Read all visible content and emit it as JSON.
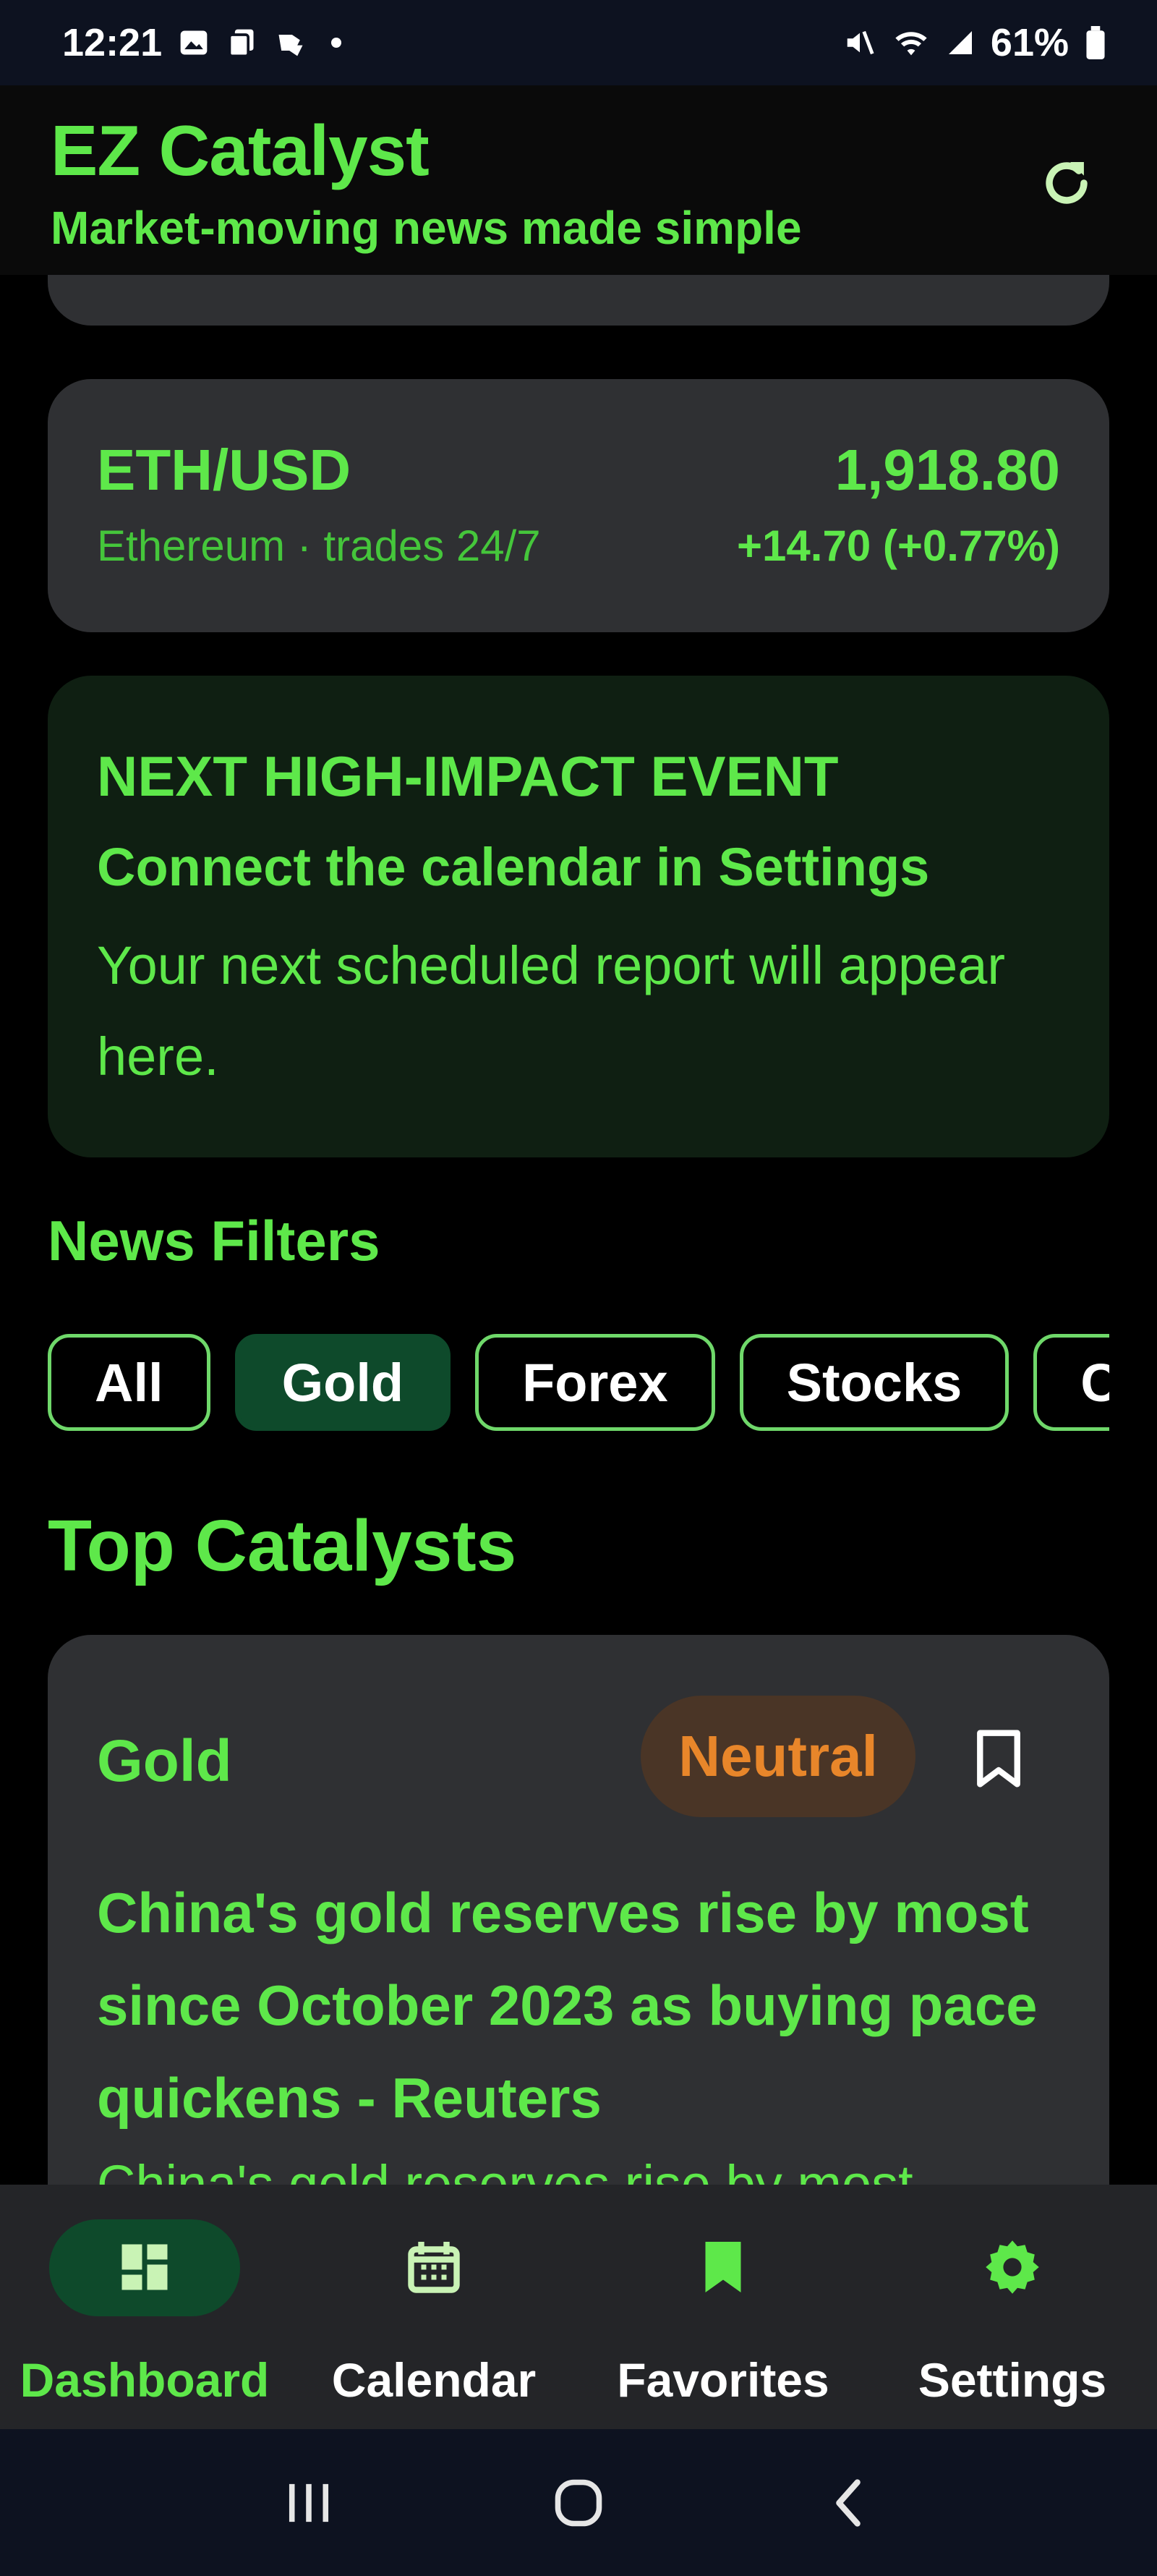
{
  "status_bar": {
    "time": "12:21",
    "battery": "61%"
  },
  "header": {
    "title": "EZ Catalyst",
    "subtitle": "Market-moving news made simple"
  },
  "ticker": {
    "symbol": "ETH/USD",
    "description": "Ethereum · trades 24/7",
    "price": "1,918.80",
    "change": "+14.70 (+0.77%)"
  },
  "event": {
    "heading": "NEXT HIGH-IMPACT EVENT",
    "line1": "Connect the calendar in Settings",
    "line2": "Your next scheduled report will appear here."
  },
  "filters": {
    "title": "News Filters",
    "chips": [
      {
        "label": "All",
        "active": false
      },
      {
        "label": "Gold",
        "active": true
      },
      {
        "label": "Forex",
        "active": false
      },
      {
        "label": "Stocks",
        "active": false
      },
      {
        "label": "C",
        "active": false
      }
    ]
  },
  "catalysts": {
    "title": "Top Catalysts",
    "items": [
      {
        "category": "Gold",
        "sentiment": "Neutral",
        "headline": "China's gold reserves rise by most since October 2023 as buying pace quickens - Reuters",
        "summary": "China's gold reserves rise by most"
      }
    ]
  },
  "nav": {
    "items": [
      {
        "label": "Dashboard",
        "icon": "dashboard-icon",
        "active": true
      },
      {
        "label": "Calendar",
        "icon": "calendar-icon",
        "active": false
      },
      {
        "label": "Favorites",
        "icon": "bookmark-icon",
        "active": false
      },
      {
        "label": "Settings",
        "icon": "gear-icon",
        "active": false
      }
    ]
  },
  "colors": {
    "accent": "#5ee84a",
    "card": "#2f3033",
    "active_chip": "#0e4a2b",
    "neutral": "#e8862a",
    "background": "#000000"
  }
}
